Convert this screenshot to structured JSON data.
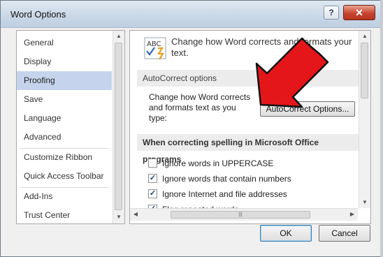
{
  "window": {
    "title": "Word Options",
    "help_label": "?",
    "close_label": "✕"
  },
  "sidebar": {
    "items": [
      {
        "label": "General"
      },
      {
        "label": "Display"
      },
      {
        "label": "Proofing",
        "selected": true
      },
      {
        "label": "Save"
      },
      {
        "label": "Language"
      },
      {
        "label": "Advanced"
      },
      {
        "label": "Customize Ribbon"
      },
      {
        "label": "Quick Access Toolbar"
      },
      {
        "label": "Add-Ins"
      },
      {
        "label": "Trust Center"
      }
    ]
  },
  "content": {
    "header_text": "Change how Word corrects and formats your text.",
    "abc_icon_label": "ABC",
    "autocorrect_section": {
      "title": "AutoCorrect options",
      "description": "Change how Word corrects and formats text as you type:",
      "button_label": "AutoCorrect Options..."
    },
    "spelling_section": {
      "title": "When correcting spelling in Microsoft Office programs",
      "options": [
        {
          "label": "Ignore words in UPPERCASE",
          "checked": false
        },
        {
          "label": "Ignore words that contain numbers",
          "checked": true
        },
        {
          "label": "Ignore Internet and file addresses",
          "checked": true
        },
        {
          "label": "Flag repeated words",
          "checked": true
        }
      ]
    }
  },
  "footer": {
    "ok_label": "OK",
    "cancel_label": "Cancel"
  },
  "colors": {
    "selected_nav": "#c5d4ec",
    "arrow_red": "#e5161a",
    "close_button": "#c8452f"
  },
  "icons": {
    "scroll_up": "▲",
    "scroll_down": "▼",
    "scroll_left": "◀",
    "scroll_right": "▶",
    "grip": "|||",
    "check": "✓"
  }
}
